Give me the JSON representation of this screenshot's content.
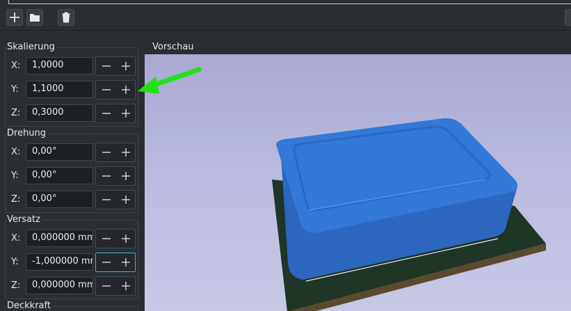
{
  "toolbar": {
    "add_icon": "plus-icon",
    "folder_icon": "folder-icon",
    "delete_icon": "trash-icon"
  },
  "scaling": {
    "title": "Skalierung",
    "rows": [
      {
        "axis": "X:",
        "value": "1,0000"
      },
      {
        "axis": "Y:",
        "value": "1,1000"
      },
      {
        "axis": "Z:",
        "value": "0,3000"
      }
    ]
  },
  "rotation": {
    "title": "Drehung",
    "rows": [
      {
        "axis": "X:",
        "value": "0,00°"
      },
      {
        "axis": "Y:",
        "value": "0,00°"
      },
      {
        "axis": "Z:",
        "value": "0,00°"
      }
    ]
  },
  "offset": {
    "title": "Versatz",
    "rows": [
      {
        "axis": "X:",
        "value": "0,000000 mm"
      },
      {
        "axis": "Y:",
        "value": "-1,000000 mm"
      },
      {
        "axis": "Z:",
        "value": "0,000000 mm"
      }
    ]
  },
  "opacity": {
    "title": "Deckkraft"
  },
  "preview": {
    "title": "Vorschau",
    "background_color": "#b4b5dc",
    "model_color": "#2f72d0",
    "board_color": "#1f3526",
    "annotation_color": "#22e01a"
  }
}
